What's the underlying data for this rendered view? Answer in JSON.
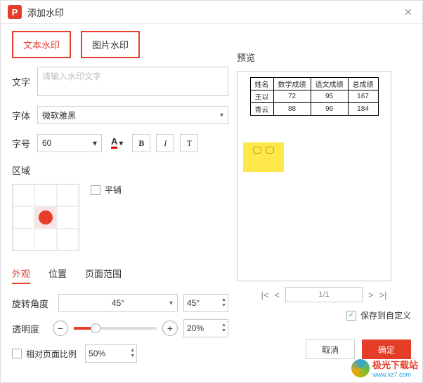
{
  "titlebar": {
    "title": "添加水印",
    "logo_letter": "P"
  },
  "tabs": {
    "text": "文本水印",
    "image": "图片水印"
  },
  "form": {
    "text_label": "文字",
    "text_placeholder": "请输入水印文字",
    "font_label": "字体",
    "font_value": "微软雅黑",
    "size_label": "字号",
    "size_value": "60",
    "bold": "B",
    "italic": "I",
    "textfx": "T"
  },
  "area": {
    "label": "区域",
    "tile": "平铺"
  },
  "subtabs": {
    "appearance": "外观",
    "position": "位置",
    "range": "页面范围"
  },
  "params": {
    "rotate_label": "旋转角度",
    "rotate_value": "45°",
    "rotate_spin": "45°",
    "opacity_label": "透明度",
    "opacity_value": "20%",
    "relative": "相对页面比例",
    "relative_value": "50%"
  },
  "preview": {
    "label": "预览",
    "pager": "1/1",
    "save_custom": "保存到自定义",
    "table": {
      "headers": [
        "姓名",
        "数学成绩",
        "语文成绩",
        "总成绩"
      ],
      "rows": [
        [
          "王以",
          "72",
          "95",
          "167"
        ],
        [
          "青云",
          "88",
          "96",
          "184"
        ]
      ]
    }
  },
  "footer": {
    "cancel": "取消",
    "ok": "确定"
  },
  "brand": {
    "name": "极光下载站",
    "url": "www.xz7.com"
  }
}
